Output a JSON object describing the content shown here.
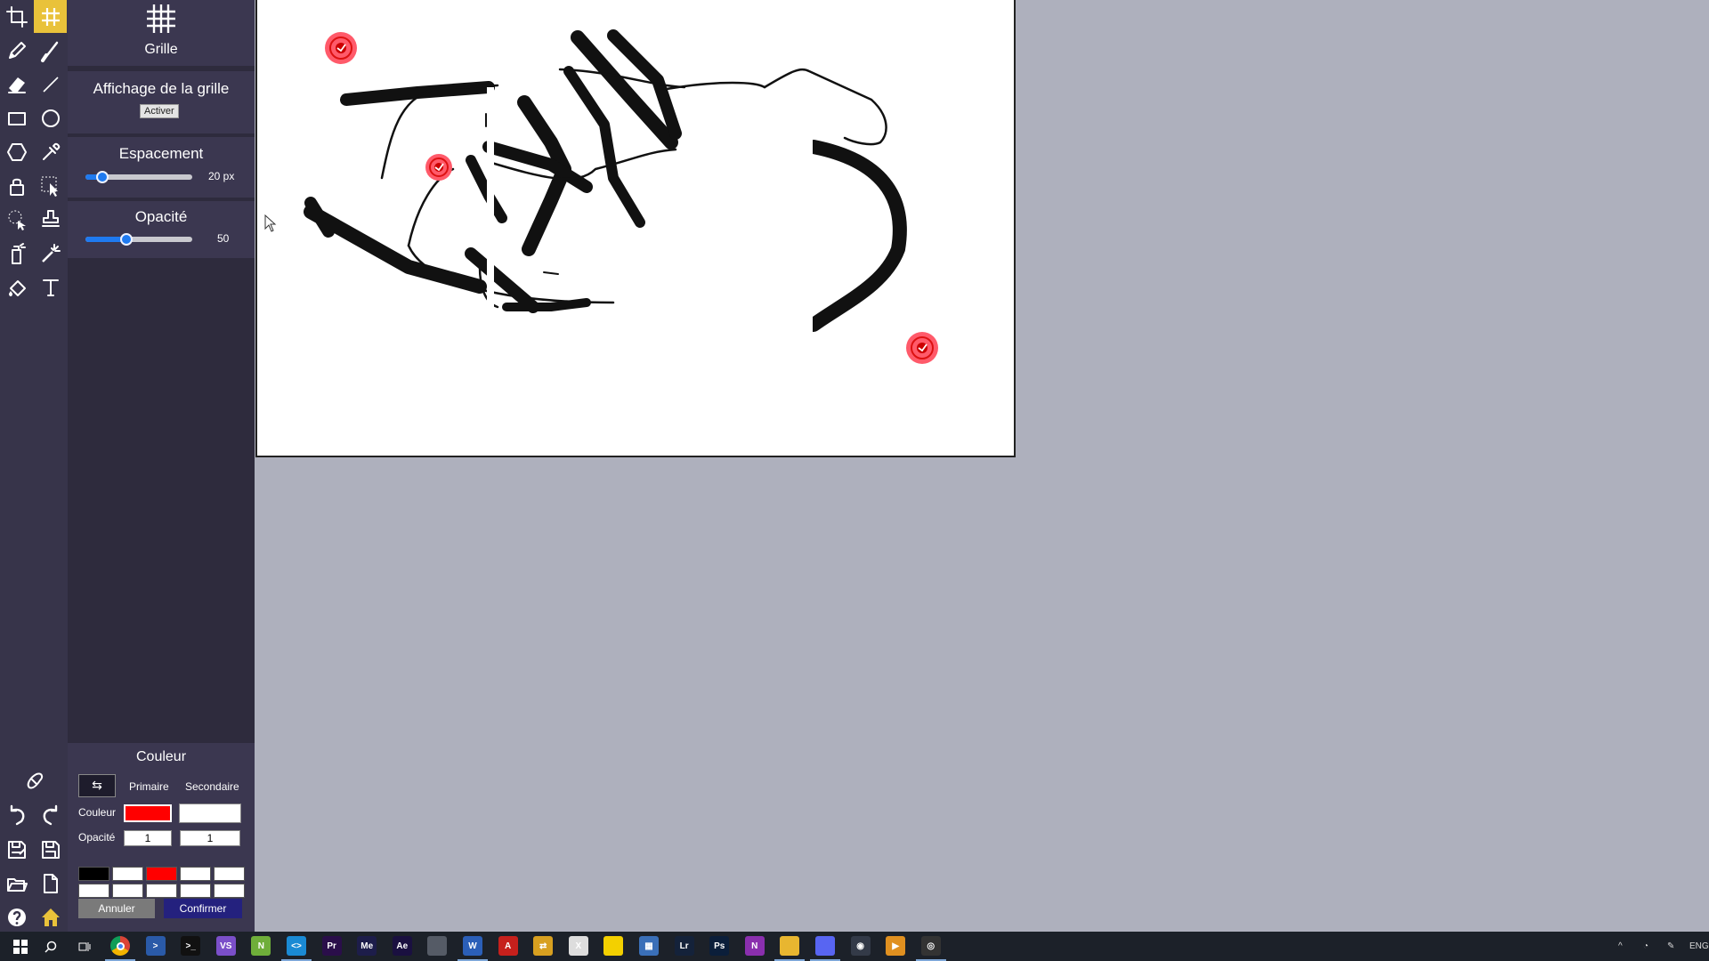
{
  "toolbox": {
    "tools": [
      "crop-icon",
      "grid-icon",
      "pencil-icon",
      "brush-icon",
      "eraser-icon",
      "line-icon",
      "rectangle-icon",
      "ellipse-icon",
      "polygon-icon",
      "eyedropper-icon",
      "lock-icon",
      "select-icon",
      "lasso-icon",
      "stamp-icon",
      "spray-icon",
      "magic-wand-icon",
      "paint-bucket-icon",
      "text-icon"
    ],
    "bottom_tools": [
      "bandage-icon",
      "undo-icon",
      "redo-icon",
      "save-as-icon",
      "save-icon",
      "open-icon",
      "new-file-icon",
      "help-icon",
      "home-icon"
    ],
    "active_tool": "grid-icon"
  },
  "grid_panel": {
    "title": "Grille",
    "display_label": "Affichage de la grille",
    "activate_button": "Activer",
    "spacing_label": "Espacement",
    "spacing_value": "20 px",
    "spacing_fraction": 0.16,
    "opacity_label": "Opacité",
    "opacity_value": "50",
    "opacity_fraction": 0.38
  },
  "color_panel": {
    "title": "Couleur",
    "swap_symbol": "⇆",
    "primary_label": "Primaire",
    "secondary_label": "Secondaire",
    "color_label": "Couleur",
    "opacity_label": "Opacité",
    "primary_color": "#ff0000",
    "secondary_color": "#ffffff",
    "primary_opacity": "1",
    "secondary_opacity": "1",
    "palette": [
      "#000000",
      "#ffffff",
      "#ff0000",
      "#ffffff",
      "#ffffff",
      "#ffffff",
      "#ffffff",
      "#ffffff",
      "#ffffff",
      "#ffffff"
    ],
    "cancel_label": "Annuler",
    "confirm_label": "Confirmer"
  },
  "colors": {
    "toolbox_bg": "#37344a",
    "panel_bg": "#2e2b3d",
    "accent": "#e9c23a",
    "slider": "#1f7af0",
    "confirm_bg": "#24217e",
    "cancel_bg": "#7a7a7a",
    "workspace": "#aeb0bd"
  },
  "taskbar": {
    "apps": [
      {
        "name": "chrome-icon",
        "color": "#e0b030",
        "text": "",
        "active": true
      },
      {
        "name": "powershell-icon",
        "color": "#2a5aa8",
        "text": ">",
        "active": false
      },
      {
        "name": "terminal-icon",
        "color": "#111111",
        "text": ">_",
        "active": false
      },
      {
        "name": "visual-studio-icon",
        "color": "#7b4fc9",
        "text": "VS",
        "active": false
      },
      {
        "name": "notepadpp-icon",
        "color": "#6fae3a",
        "text": "N",
        "active": false
      },
      {
        "name": "vscode-icon",
        "color": "#1a8ad4",
        "text": "<>",
        "active": true
      },
      {
        "name": "premiere-icon",
        "color": "#2a0e4a",
        "text": "Pr",
        "active": false
      },
      {
        "name": "media-encoder-icon",
        "color": "#1d1d4a",
        "text": "Me",
        "active": false
      },
      {
        "name": "after-effects-icon",
        "color": "#1a1040",
        "text": "Ae",
        "active": false
      },
      {
        "name": "spotify-like-icon",
        "color": "#555b66",
        "text": "",
        "active": false
      },
      {
        "name": "word-icon",
        "color": "#2b5fb8",
        "text": "W",
        "active": true
      },
      {
        "name": "acrobat-icon",
        "color": "#c6201c",
        "text": "A",
        "active": false
      },
      {
        "name": "transfer-icon",
        "color": "#d8a020",
        "text": "⇄",
        "active": false
      },
      {
        "name": "excel-like-icon",
        "color": "#dddddd",
        "text": "X",
        "active": false
      },
      {
        "name": "sticky-notes-icon",
        "color": "#f3d000",
        "text": "",
        "active": false
      },
      {
        "name": "calculator-icon",
        "color": "#3a6fb8",
        "text": "▦",
        "active": false
      },
      {
        "name": "lightroom-icon",
        "color": "#14223a",
        "text": "Lr",
        "active": false
      },
      {
        "name": "photoshop-icon",
        "color": "#0b1e3a",
        "text": "Ps",
        "active": false
      },
      {
        "name": "onenote-icon",
        "color": "#8a2fae",
        "text": "N",
        "active": false
      },
      {
        "name": "file-explorer-icon",
        "color": "#e8b630",
        "text": "",
        "active": true
      },
      {
        "name": "discord-icon",
        "color": "#5865f2",
        "text": "",
        "active": true
      },
      {
        "name": "vpn-icon",
        "color": "#333a48",
        "text": "◉",
        "active": false
      },
      {
        "name": "media-player-icon",
        "color": "#e09020",
        "text": "▶",
        "active": false
      },
      {
        "name": "obs-icon",
        "color": "#333333",
        "text": "◎",
        "active": true
      }
    ],
    "tray_lang": "ENG"
  }
}
